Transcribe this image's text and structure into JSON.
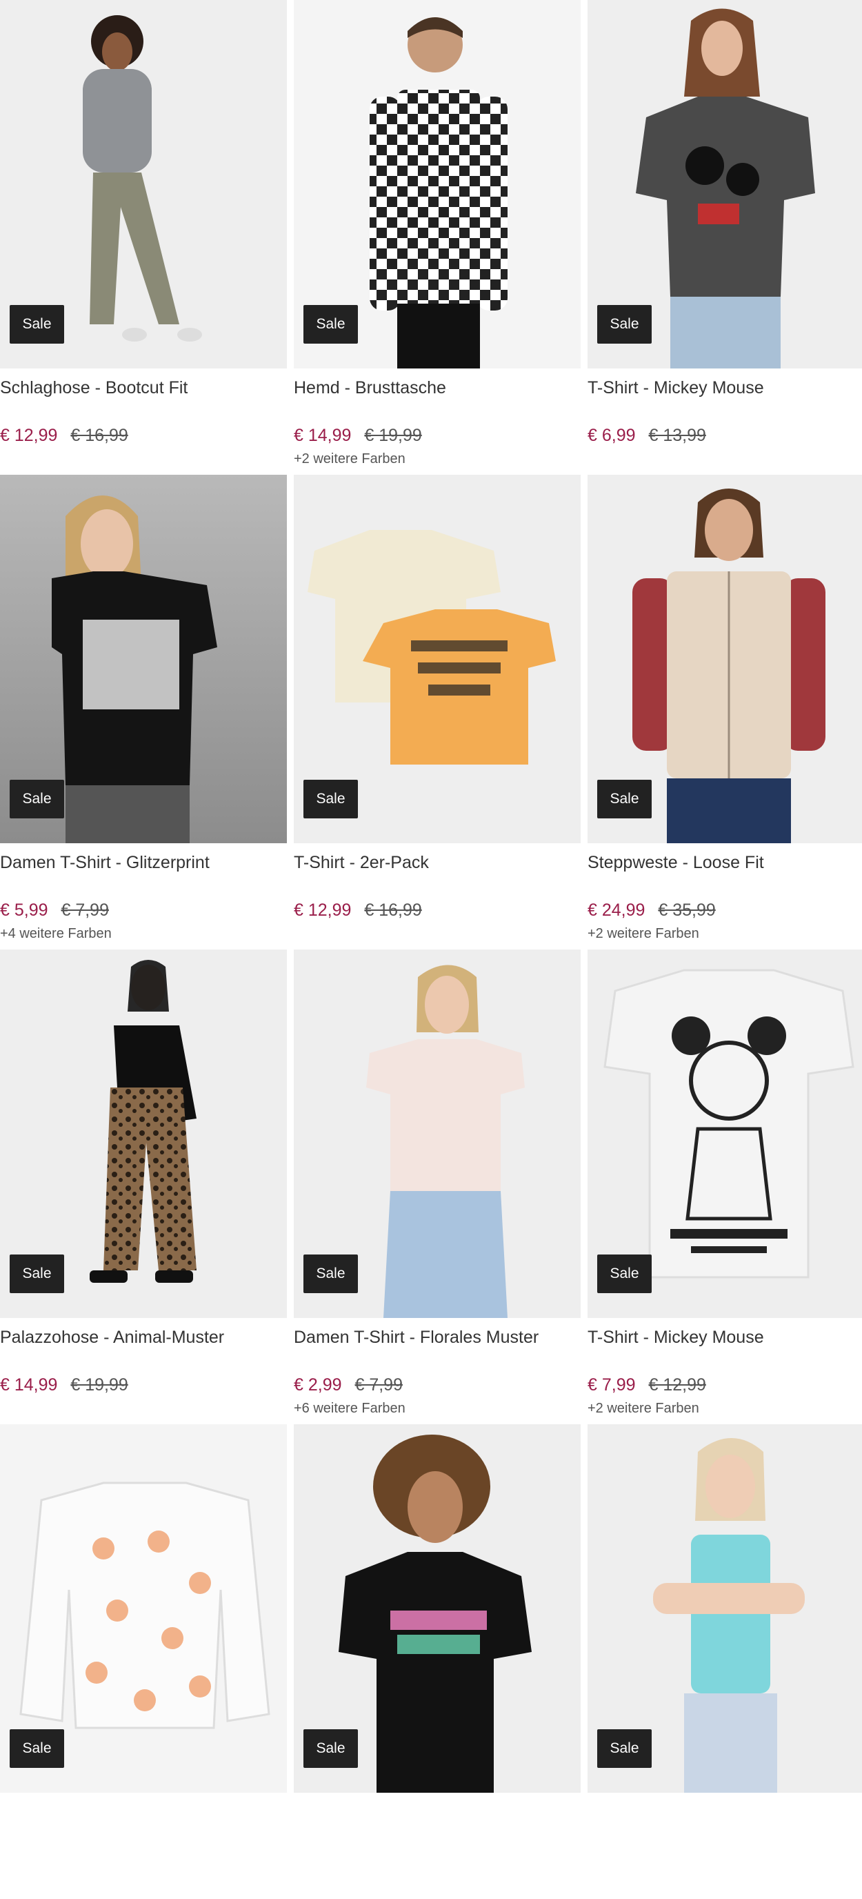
{
  "sale_label": "Sale",
  "products": [
    {
      "name": "Schlaghose - Bootcut Fit",
      "price": "€ 12,99",
      "old_price": "€ 16,99",
      "colors": ""
    },
    {
      "name": "Hemd - Brusttasche",
      "price": "€ 14,99",
      "old_price": "€ 19,99",
      "colors": "+2 weitere Farben"
    },
    {
      "name": "T-Shirt - Mickey Mouse",
      "price": "€ 6,99",
      "old_price": "€ 13,99",
      "colors": ""
    },
    {
      "name": "Damen T-Shirt - Glitzerprint",
      "price": "€ 5,99",
      "old_price": "€ 7,99",
      "colors": "+4 weitere Farben"
    },
    {
      "name": "T-Shirt - 2er-Pack",
      "price": "€ 12,99",
      "old_price": "€ 16,99",
      "colors": ""
    },
    {
      "name": "Steppweste - Loose Fit",
      "price": "€ 24,99",
      "old_price": "€ 35,99",
      "colors": "+2 weitere Farben"
    },
    {
      "name": "Palazzohose - Animal-Muster",
      "price": "€ 14,99",
      "old_price": "€ 19,99",
      "colors": ""
    },
    {
      "name": "Damen T-Shirt - Florales Muster",
      "price": "€ 2,99",
      "old_price": "€ 7,99",
      "colors": "+6 weitere Farben"
    },
    {
      "name": "T-Shirt - Mickey Mouse",
      "price": "€ 7,99",
      "old_price": "€ 12,99",
      "colors": "+2 weitere Farben"
    }
  ],
  "colors": {
    "price": "#9a1e4a",
    "sale_badge": "#222222"
  }
}
